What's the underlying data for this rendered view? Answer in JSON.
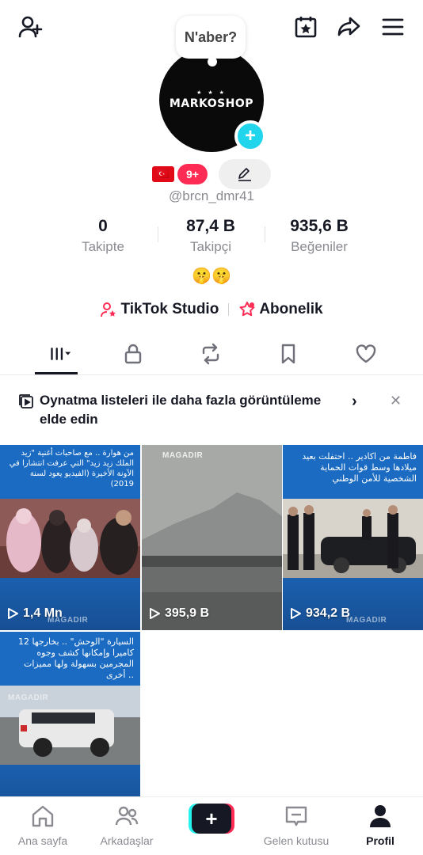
{
  "header": {
    "add_friend_icon": "person-add-icon",
    "calendar_icon": "calendar-star-icon",
    "share_icon": "share-icon",
    "menu_icon": "menu-icon"
  },
  "profile": {
    "bubble_text": "N'aber?",
    "avatar_text": "MARKOSHOP",
    "avatar_stars": "★ ★ ★",
    "plus": "+",
    "flag": "🇹🇷",
    "badge_count": "9+",
    "username": "@brcn_dmr41",
    "bio": "🤫🤫"
  },
  "stats": [
    {
      "value": "0",
      "label": "Takipte"
    },
    {
      "value": "87,4 B",
      "label": "Takipçi"
    },
    {
      "value": "935,6 B",
      "label": "Beğeniler"
    }
  ],
  "links": {
    "studio": "TikTok Studio",
    "subscription": "Abonelik"
  },
  "banner": {
    "text": "Oynatma listeleri ile daha fazla görüntüleme elde edin",
    "arrow": "›",
    "close": "✕"
  },
  "videos": [
    {
      "views": "1,4 Mn",
      "caption": "من هوارة .. مع صاحبات أغنية \"زيد الملك زيد زيد\" التي عرفت انتشارا في الآونة الأخيرة (الفيديو يعود لسنة 2019)",
      "watermark": "MAGADIR"
    },
    {
      "views": "395,9 B",
      "caption": "",
      "watermark": "MAGADIR"
    },
    {
      "views": "934,2 B",
      "caption": "فاطمة من اكادير .. احتفلت بعيد ميلادها وسط قوات الحماية الشخصية للأمن الوطني",
      "watermark": "MAGADIR"
    },
    {
      "views": "",
      "caption": "السيارة \"الوحش\" .. بخارجها 12 كاميرا وإمكانها كشف وجوه المجرمين بسهولة ولها مميزات أخرى ..",
      "watermark": "MAGADIR"
    }
  ],
  "nav": {
    "home": "Ana sayfa",
    "friends": "Arkadaşlar",
    "create": "+",
    "inbox": "Gelen kutusu",
    "profile": "Profil"
  },
  "colors": {
    "accent_pink": "#fe2c55",
    "accent_cyan": "#25f4ee",
    "text_dark": "#161823",
    "text_grey": "#8a8b91",
    "video_blue": "#1a6bc1"
  }
}
